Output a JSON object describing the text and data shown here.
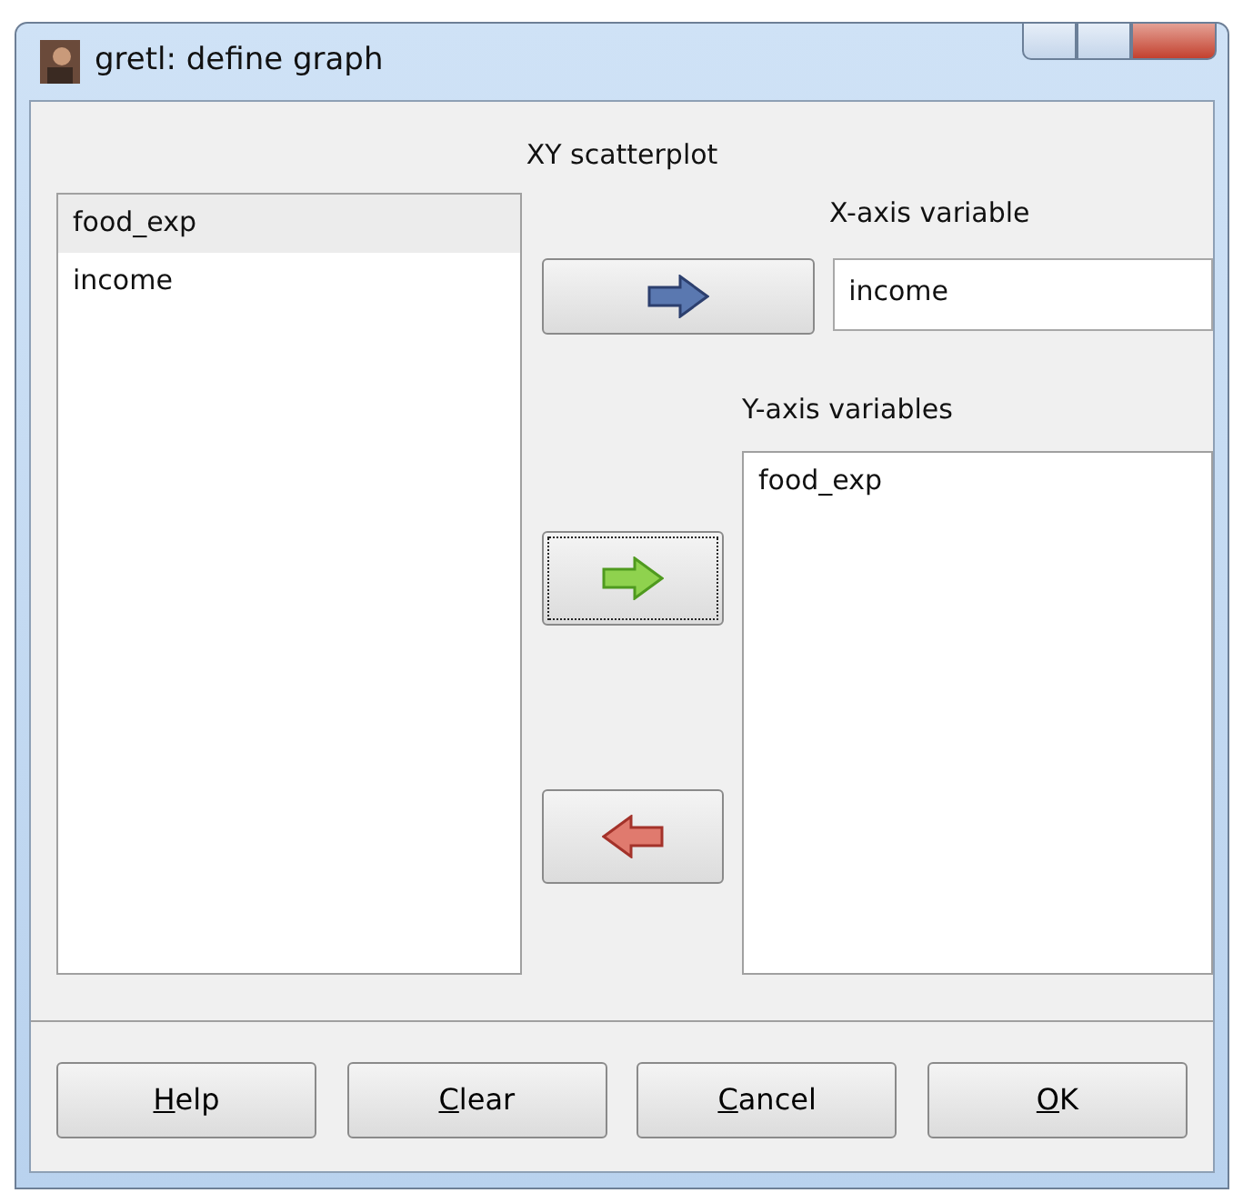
{
  "window": {
    "title": "gretl: define graph"
  },
  "heading": "XY scatterplot",
  "variables": [
    {
      "name": "food_exp",
      "selected": true
    },
    {
      "name": "income",
      "selected": false
    }
  ],
  "x_axis": {
    "label": "X-axis variable",
    "value": "income"
  },
  "y_axis": {
    "label": "Y-axis variables",
    "items": [
      {
        "name": "food_exp",
        "selected": false
      }
    ]
  },
  "arrow_buttons": [
    {
      "kind": "set-x",
      "focused": false
    },
    {
      "kind": "add-y",
      "focused": true
    },
    {
      "kind": "remove-y",
      "focused": false
    }
  ],
  "buttons": [
    {
      "label": "Help",
      "mnemonic": true
    },
    {
      "label": "Clear",
      "mnemonic": true
    },
    {
      "label": "Cancel",
      "mnemonic": true
    },
    {
      "label": "OK",
      "mnemonic": true
    }
  ]
}
